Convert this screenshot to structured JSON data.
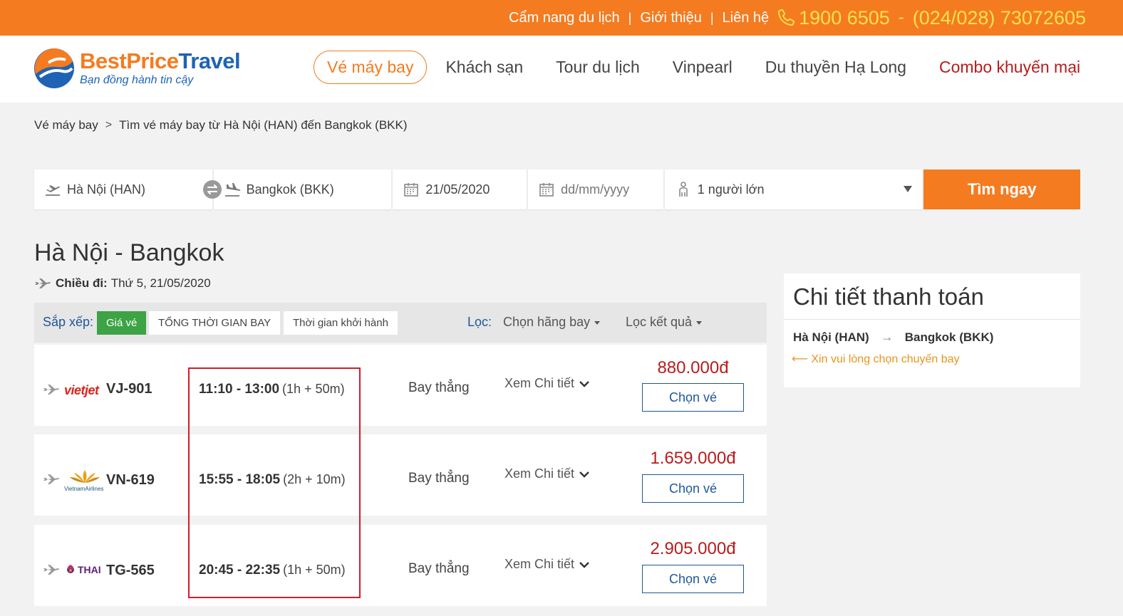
{
  "topbar": {
    "links": [
      "Cẩm nang du lịch",
      "Giới thiệu",
      "Liên hệ"
    ],
    "separator": "|",
    "hotline": "1900 6505",
    "dash": "-",
    "phone": "(024/028) 73072605"
  },
  "brand": {
    "name_part1": "BestPrice",
    "name_part2": "Travel",
    "slogan": "Bạn đồng hành tin cậy"
  },
  "nav": {
    "items": [
      "Vé máy bay",
      "Khách sạn",
      "Tour du lịch",
      "Vinpearl",
      "Du thuyền Hạ Long",
      "Combo khuyến mại"
    ],
    "active": "Vé máy bay"
  },
  "breadcrumb": {
    "home": "Vé máy bay",
    "separator": ">",
    "current": "Tìm vé máy bay từ Hà Nội (HAN) đến Bangkok (BKK)"
  },
  "search": {
    "from": "Hà Nội (HAN)",
    "to": "Bangkok (BKK)",
    "depart_date": "21/05/2020",
    "return_date_placeholder": "dd/mm/yyyy",
    "passengers": "1 người lớn",
    "button": "Tìm ngay"
  },
  "results": {
    "route_title": "Hà Nội - Bangkok",
    "direction_label": "Chiều đi:",
    "direction_date": "Thứ 5, 21/05/2020"
  },
  "sortbar": {
    "sort_label": "Sắp xếp:",
    "sort_options": [
      "Giá vé",
      "TỔNG THỜI GIAN BAY",
      "Thời gian khởi hành"
    ],
    "active_sort": "Giá vé",
    "filter_label": "Lọc:",
    "filter_airline": "Chọn hãng bay",
    "filter_results": "Lọc kết quả"
  },
  "flights": [
    {
      "airline": "vietjet",
      "airline_logo_text": "vietjet",
      "code": "VJ-901",
      "times": "11:10 - 13:00",
      "duration": "(1h + 50m)",
      "type": "Bay thẳng",
      "detail": "Xem Chi tiết",
      "price": "880.000đ",
      "button": "Chọn vé"
    },
    {
      "airline": "vietnam-airlines",
      "airline_logo_text": "VietnamAirlines",
      "code": "VN-619",
      "times": "15:55 - 18:05",
      "duration": "(2h + 10m)",
      "type": "Bay thẳng",
      "detail": "Xem Chi tiết",
      "price": "1.659.000đ",
      "button": "Chọn vé"
    },
    {
      "airline": "thai-airways",
      "airline_logo_text": "THAI",
      "code": "TG-565",
      "times": "20:45 - 22:35",
      "duration": "(1h + 50m)",
      "type": "Bay thẳng",
      "detail": "Xem Chi tiết",
      "price": "2.905.000đ",
      "button": "Chọn vé"
    }
  ],
  "payment": {
    "title": "Chi tiết thanh toán",
    "from": "Hà Nội (HAN)",
    "arrow": "→",
    "to": "Bangkok (BKK)",
    "note": "⟵ Xin vui lòng chọn chuyến bay"
  },
  "colors": {
    "brand_orange": "#f47b20",
    "brand_blue": "#1e63b4",
    "price_red": "#b81c1c",
    "highlight_red": "#d31c2a",
    "sort_active_green": "#3da345",
    "hotline_yellow": "#ffe14d"
  }
}
